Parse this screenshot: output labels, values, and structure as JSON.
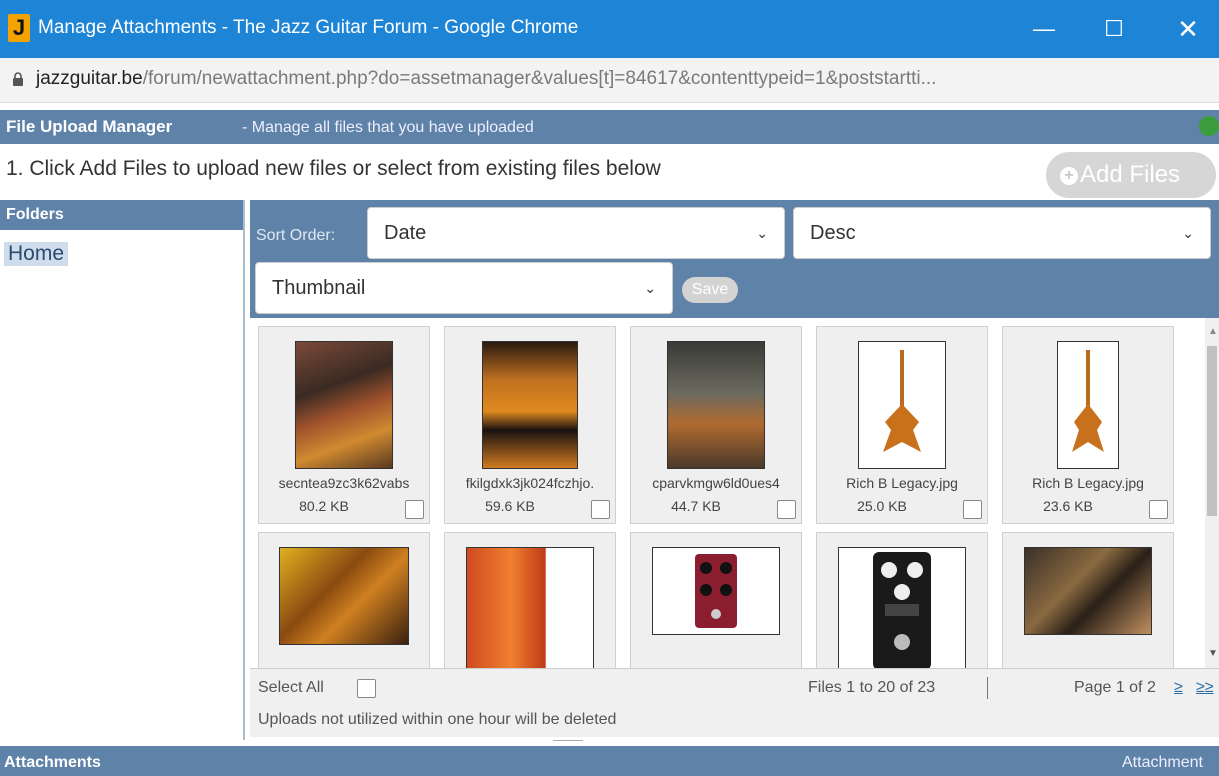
{
  "window": {
    "title": "Manage Attachments - The Jazz Guitar Forum - Google Chrome",
    "logo": "J",
    "minimize": "—",
    "maximize": "☐",
    "close": "✕"
  },
  "address": {
    "domain": "jazzguitar.be",
    "path": "/forum/newattachment.php?do=assetmanager&values[t]=84617&contenttypeid=1&poststartti..."
  },
  "manager": {
    "title": "File Upload Manager",
    "subtitle": "- Manage all files that you have uploaded",
    "instructions": "1. Click Add Files to upload new files or select from existing files below",
    "add_files_label": "Add Files",
    "add_files_icon": "+"
  },
  "folders": {
    "header": "Folders",
    "items": [
      "Home"
    ]
  },
  "toolbar": {
    "sort_label": "Sort Order:",
    "sort_value": "Date",
    "direction_value": "Desc",
    "view_value": "Thumbnail",
    "save_label": "Save",
    "caret": "⌄"
  },
  "files": [
    {
      "name": "secntea9zc3k62vabs",
      "size": "80.2 KB"
    },
    {
      "name": "fkilgdxk3jk024fczhjo.",
      "size": "59.6 KB"
    },
    {
      "name": "cparvkmgw6ld0ues4",
      "size": "44.7 KB"
    },
    {
      "name": "Rich B Legacy.jpg",
      "size": "25.0 KB"
    },
    {
      "name": "Rich B Legacy.jpg",
      "size": "23.6 KB"
    },
    {
      "name": "",
      "size": ""
    },
    {
      "name": "",
      "size": ""
    },
    {
      "name": "",
      "size": ""
    },
    {
      "name": "",
      "size": ""
    },
    {
      "name": "",
      "size": ""
    }
  ],
  "footer": {
    "select_all": "Select All",
    "files_count": "Files 1 to 20 of 23",
    "page_info": "Page 1 of 2",
    "next": "≥",
    "last": "≥≥",
    "note": "Uploads not utilized within one hour will be deleted"
  },
  "attachments": {
    "title": "Attachments",
    "right_label": "Attachment"
  },
  "colors": {
    "titlebar": "#1e85d6",
    "header_blue": "#5f83a8",
    "folder_highlight": "#cfdceb"
  }
}
